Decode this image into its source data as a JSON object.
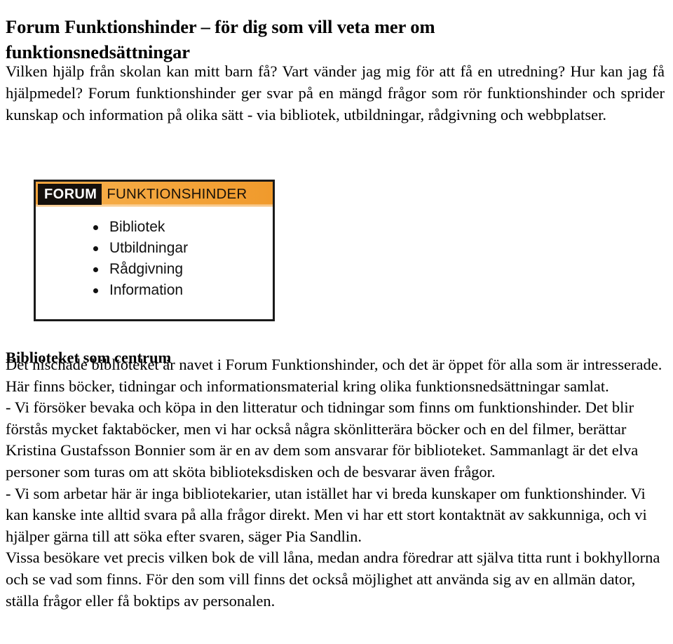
{
  "document": {
    "title": "Forum Funktionshinder – för dig som vill veta mer om funktionsnedsättningar",
    "intro": "Vilken hjälp från skolan kan mitt barn få? Vart vänder jag mig för att få en utredning? Hur kan jag få hjälpmedel?  Forum funktionshinder ger svar på en mängd frågor som rör funktionshinder och sprider kunskap och information på olika sätt - via bibliotek, utbildningar, rådgivning och webbplatser."
  },
  "logo": {
    "brand_box": "FORUM",
    "brand_word": "FUNKTIONSHINDER",
    "banner_color": "#f2a33d",
    "brand_box_color": "#15100c",
    "items": [
      "Bibliotek",
      "Utbildningar",
      "Rådgivning",
      "Information"
    ]
  },
  "section": {
    "heading": "Biblioteket som centrum",
    "paragraphs": [
      "Det nischade biblioteket är navet i Forum Funktionshinder, och det är öppet för alla som är intresserade. Här finns böcker, tidningar och informationsmaterial kring olika funktionsnedsättningar samlat.",
      "- Vi försöker bevaka och köpa in den litteratur och tidningar som finns om funktionshinder. Det blir förstås mycket faktaböcker, men vi har också några skönlitterära böcker och en del filmer, berättar Kristina Gustafsson Bonnier som är en av dem som ansvarar för biblioteket. Sammanlagt är det elva personer som turas om att sköta biblioteksdisken och de besvarar även frågor.",
      "- Vi som arbetar här är inga bibliotekarier, utan istället har vi breda kunskaper om funktionshinder. Vi kan kanske inte alltid svara på alla frågor direkt. Men vi har ett stort kontaktnät av sakkunniga, och vi hjälper gärna till att söka efter svaren, säger Pia Sandlin.",
      "Vissa besökare vet precis vilken bok de vill låna, medan andra föredrar att själva titta runt i bokhyllorna och se vad som finns. För den som vill finns det också möjlighet att använda sig av en allmän dator, ställa frågor eller få boktips av personalen."
    ]
  }
}
